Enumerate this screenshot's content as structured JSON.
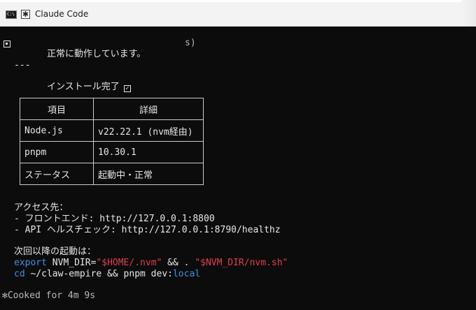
{
  "window": {
    "title": "Claude Code",
    "title_icon": "cmd-icon",
    "tab_icon": "asterisk-icon"
  },
  "terminal": {
    "status_line": "正常に動作しています。",
    "status_trailing": "s)",
    "separator": "---",
    "install_complete": "インストール完了",
    "check_glyph": "✓",
    "table": {
      "headers": [
        "項目",
        "詳細"
      ],
      "rows": [
        [
          "Node.js",
          "v22.22.1 (nvm経由)"
        ],
        [
          "pnpm",
          "10.30.1"
        ],
        [
          "ステータス",
          "起動中・正常"
        ]
      ]
    },
    "access_heading": "アクセス先：",
    "access_frontend": "- フロントエンド: http://127.0.0.1:8800",
    "access_api": "- API ヘルスチェック: http://127.0.0.1:8790/healthz",
    "next_heading": "次回以降の起動は：",
    "cmd1": {
      "export": "export",
      "var": " NVM_DIR=",
      "val": "\"$HOME/.nvm\"",
      "and": " && . ",
      "path": "\"$NVM_DIR/nvm.sh\""
    },
    "cmd2": {
      "cd": "cd",
      "rest": " ~/claw-empire && pnpm dev:",
      "local": "local"
    },
    "cooked": "✻Cooked for 4m 9s"
  },
  "colors": {
    "background": "#0c0c0c",
    "text": "#e6e6e6",
    "keyword_blue": "#3f8fe6",
    "string_red": "#e0404a"
  }
}
